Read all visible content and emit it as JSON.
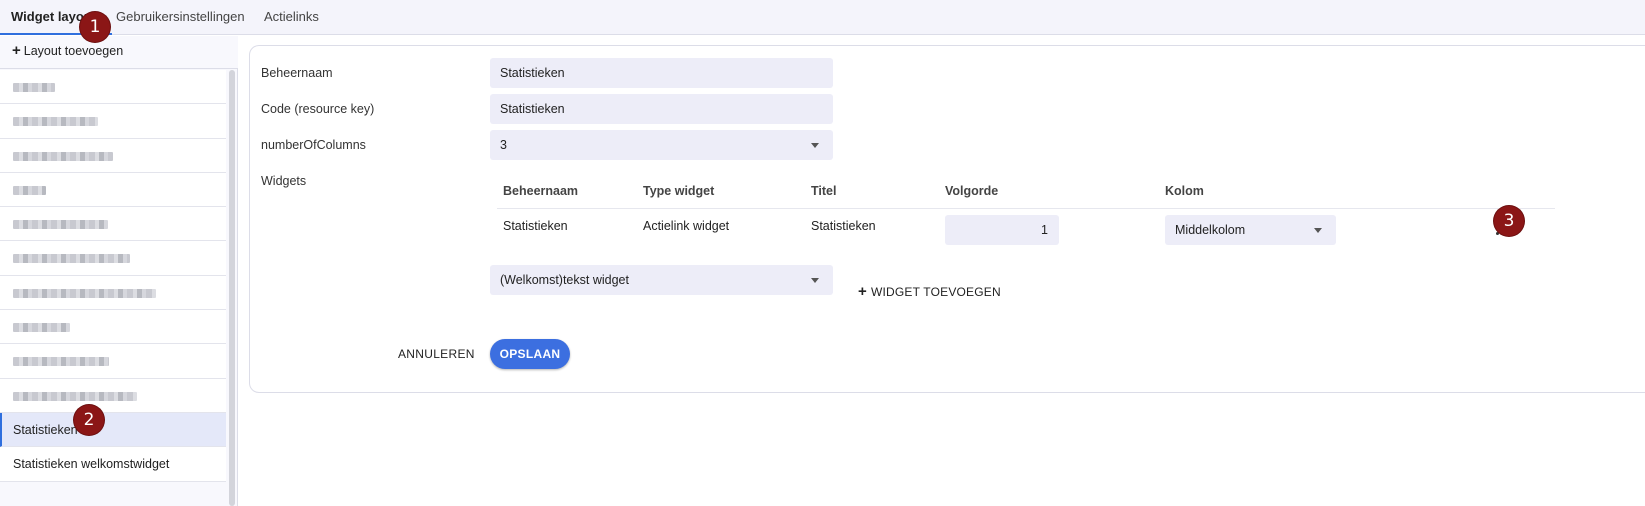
{
  "tabs": [
    {
      "label": "Widget layouts",
      "active": true
    },
    {
      "label": "Gebruikersinstellingen",
      "active": false
    },
    {
      "label": "Actielinks",
      "active": false
    }
  ],
  "badges": {
    "one": "1",
    "two": "2",
    "three": "3"
  },
  "sidebar": {
    "add_label": "Layout toevoegen",
    "items": [
      {
        "label": "",
        "blurred": true
      },
      {
        "label": "",
        "blurred": true
      },
      {
        "label": "",
        "blurred": true
      },
      {
        "label": "",
        "blurred": true
      },
      {
        "label": "",
        "blurred": true
      },
      {
        "label": "",
        "blurred": true
      },
      {
        "label": "",
        "blurred": true
      },
      {
        "label": "",
        "blurred": true
      },
      {
        "label": "",
        "blurred": true
      },
      {
        "label": "",
        "blurred": true
      },
      {
        "label": "Statistieken",
        "selected": true
      },
      {
        "label": "Statistieken welkomstwidget"
      }
    ]
  },
  "form": {
    "beheernaam_label": "Beheernaam",
    "beheernaam_value": "Statistieken",
    "code_label": "Code (resource key)",
    "code_value": "Statistieken",
    "columns_label": "numberOfColumns",
    "columns_value": "3",
    "widgets_label": "Widgets"
  },
  "widgets_table": {
    "headers": [
      "Beheernaam",
      "Type widget",
      "Titel",
      "Volgorde",
      "Kolom"
    ],
    "rows": [
      {
        "beheernaam": "Statistieken",
        "type": "Actielink widget",
        "titel": "Statistieken",
        "volgorde": "1",
        "kolom": "Middelkolom"
      }
    ]
  },
  "widget_type_select": "(Welkomst)tekst widget",
  "add_widget_label": "WIDGET TOEVOEGEN",
  "actions": {
    "cancel": "ANNULEREN",
    "save": "OPSLAAN"
  },
  "colors": {
    "accent": "#3c6fe0",
    "badge": "#8b1616",
    "field_bg": "#ededf8",
    "selected_bg": "#e4e8f9"
  }
}
